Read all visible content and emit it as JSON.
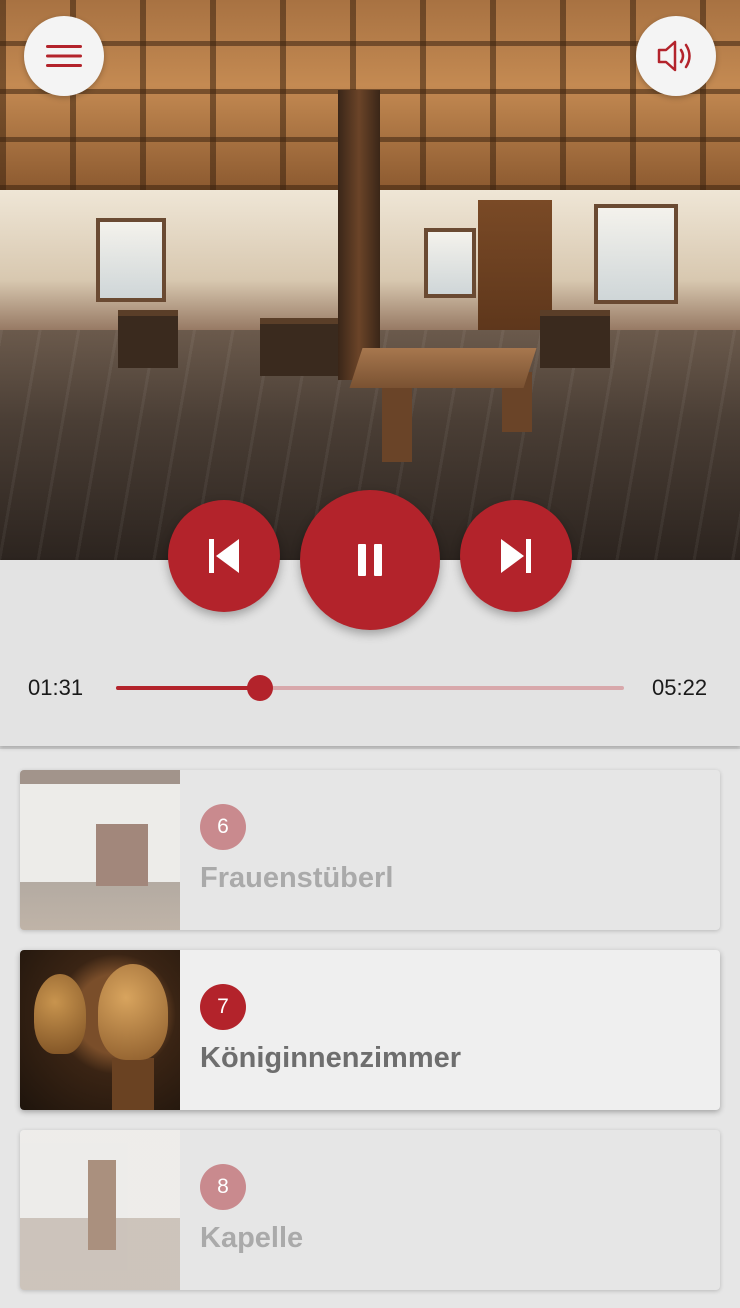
{
  "app": {
    "colors": {
      "accent": "#b3232b",
      "accent_light": "#c98a8e",
      "panel_bg": "#e3e3e3"
    },
    "icons": {
      "menu": "hamburger-icon",
      "sound": "speaker-icon",
      "prev": "skip-previous-icon",
      "pause": "pause-icon",
      "next": "skip-next-icon"
    }
  },
  "player": {
    "current_time": "01:31",
    "total_time": "05:22",
    "progress": 0.283
  },
  "tracks": [
    {
      "number": "6",
      "title": "Frauenstüberl",
      "state": "inactive"
    },
    {
      "number": "7",
      "title": "Königinnenzimmer",
      "state": "active"
    },
    {
      "number": "8",
      "title": "Kapelle",
      "state": "inactive"
    }
  ]
}
